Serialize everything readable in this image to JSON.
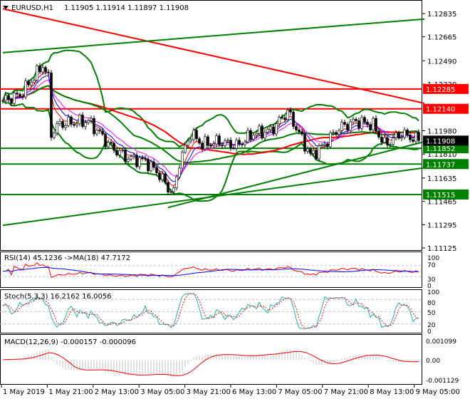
{
  "header": {
    "symbol": "EURUSD,H1",
    "ohlc": "1.11905 1.11914 1.11897 1.11908"
  },
  "chart_data": {
    "type": "candlestick",
    "symbol": "EURUSD",
    "timeframe": "H1",
    "ylim": [
      1.111,
      1.129
    ],
    "price_ticks": [
      "1.12835",
      "1.12665",
      "1.12490",
      "1.12320",
      "1.11980",
      "1.11810",
      "1.11635",
      "1.11465",
      "1.11295",
      "1.11125"
    ],
    "time_ticks": [
      "1 May 2019",
      "1 May 21:00",
      "2 May 13:00",
      "3 May 05:00",
      "3 May 21:00",
      "6 May 13:00",
      "7 May 05:00",
      "7 May 21:00",
      "8 May 13:00",
      "9 May 05:00"
    ],
    "price_keypoints": [
      [
        0,
        1.122
      ],
      [
        6,
        1.1224
      ],
      [
        12,
        1.124
      ],
      [
        14,
        1.1246
      ],
      [
        16,
        1.1236
      ],
      [
        17,
        1.1196
      ],
      [
        20,
        1.1203
      ],
      [
        30,
        1.1205
      ],
      [
        34,
        1.1196
      ],
      [
        38,
        1.1186
      ],
      [
        44,
        1.1178
      ],
      [
        50,
        1.1176
      ],
      [
        55,
        1.1166
      ],
      [
        58,
        1.1156
      ],
      [
        60,
        1.1153
      ],
      [
        62,
        1.1175
      ],
      [
        66,
        1.1196
      ],
      [
        70,
        1.1188
      ],
      [
        76,
        1.119
      ],
      [
        82,
        1.1187
      ],
      [
        88,
        1.1196
      ],
      [
        94,
        1.1198
      ],
      [
        100,
        1.1212
      ],
      [
        104,
        1.1196
      ],
      [
        108,
        1.118
      ],
      [
        112,
        1.1186
      ],
      [
        118,
        1.12
      ],
      [
        124,
        1.1205
      ],
      [
        130,
        1.1202
      ],
      [
        134,
        1.1188
      ],
      [
        140,
        1.1196
      ],
      [
        146,
        1.11908
      ]
    ],
    "levels": [
      {
        "price": "1.12285",
        "color": "#ff0000"
      },
      {
        "price": "1.12140",
        "color": "#ff0000"
      },
      {
        "price": "1.11852",
        "color": "#008000"
      },
      {
        "price": "1.11737",
        "color": "#008000"
      },
      {
        "price": "1.11515",
        "color": "#008000"
      }
    ],
    "current_price": "1.11908",
    "trendlines": [
      {
        "color": "#ff0000",
        "from": [
          0,
          1.1287
        ],
        "to": [
          148,
          1.1218
        ]
      },
      {
        "color": "#008000",
        "from": [
          0,
          1.1255
        ],
        "to": [
          148,
          1.12795
        ]
      },
      {
        "color": "#008000",
        "from": [
          0,
          1.1129
        ],
        "to": [
          148,
          1.1171
        ]
      },
      {
        "color": "#008000",
        "from": [
          58,
          1.1142
        ],
        "to": [
          148,
          1.119
        ]
      }
    ],
    "rsi": {
      "label": "RSI(14) 45.1236  ->MA(18) 47.7172",
      "levels": [
        "100",
        "70",
        "30",
        "0"
      ]
    },
    "stoch": {
      "label": "Stoch(5,3,3) 16.2162 16.0056",
      "levels": [
        "100",
        "80",
        "50",
        "20",
        "0"
      ]
    },
    "macd": {
      "label": "MACD(12,26,9) -0.000157 -0.000096",
      "levels": [
        "0.001099",
        "0.00",
        "-0.001129"
      ]
    }
  },
  "colors": {
    "bull": "#ffffff",
    "bear": "#000000",
    "band": "#008000",
    "ma_long": "#ff0000",
    "signal": "#0000ff",
    "stoch_main": "#20b2aa",
    "hist": "#c0c0c0"
  }
}
